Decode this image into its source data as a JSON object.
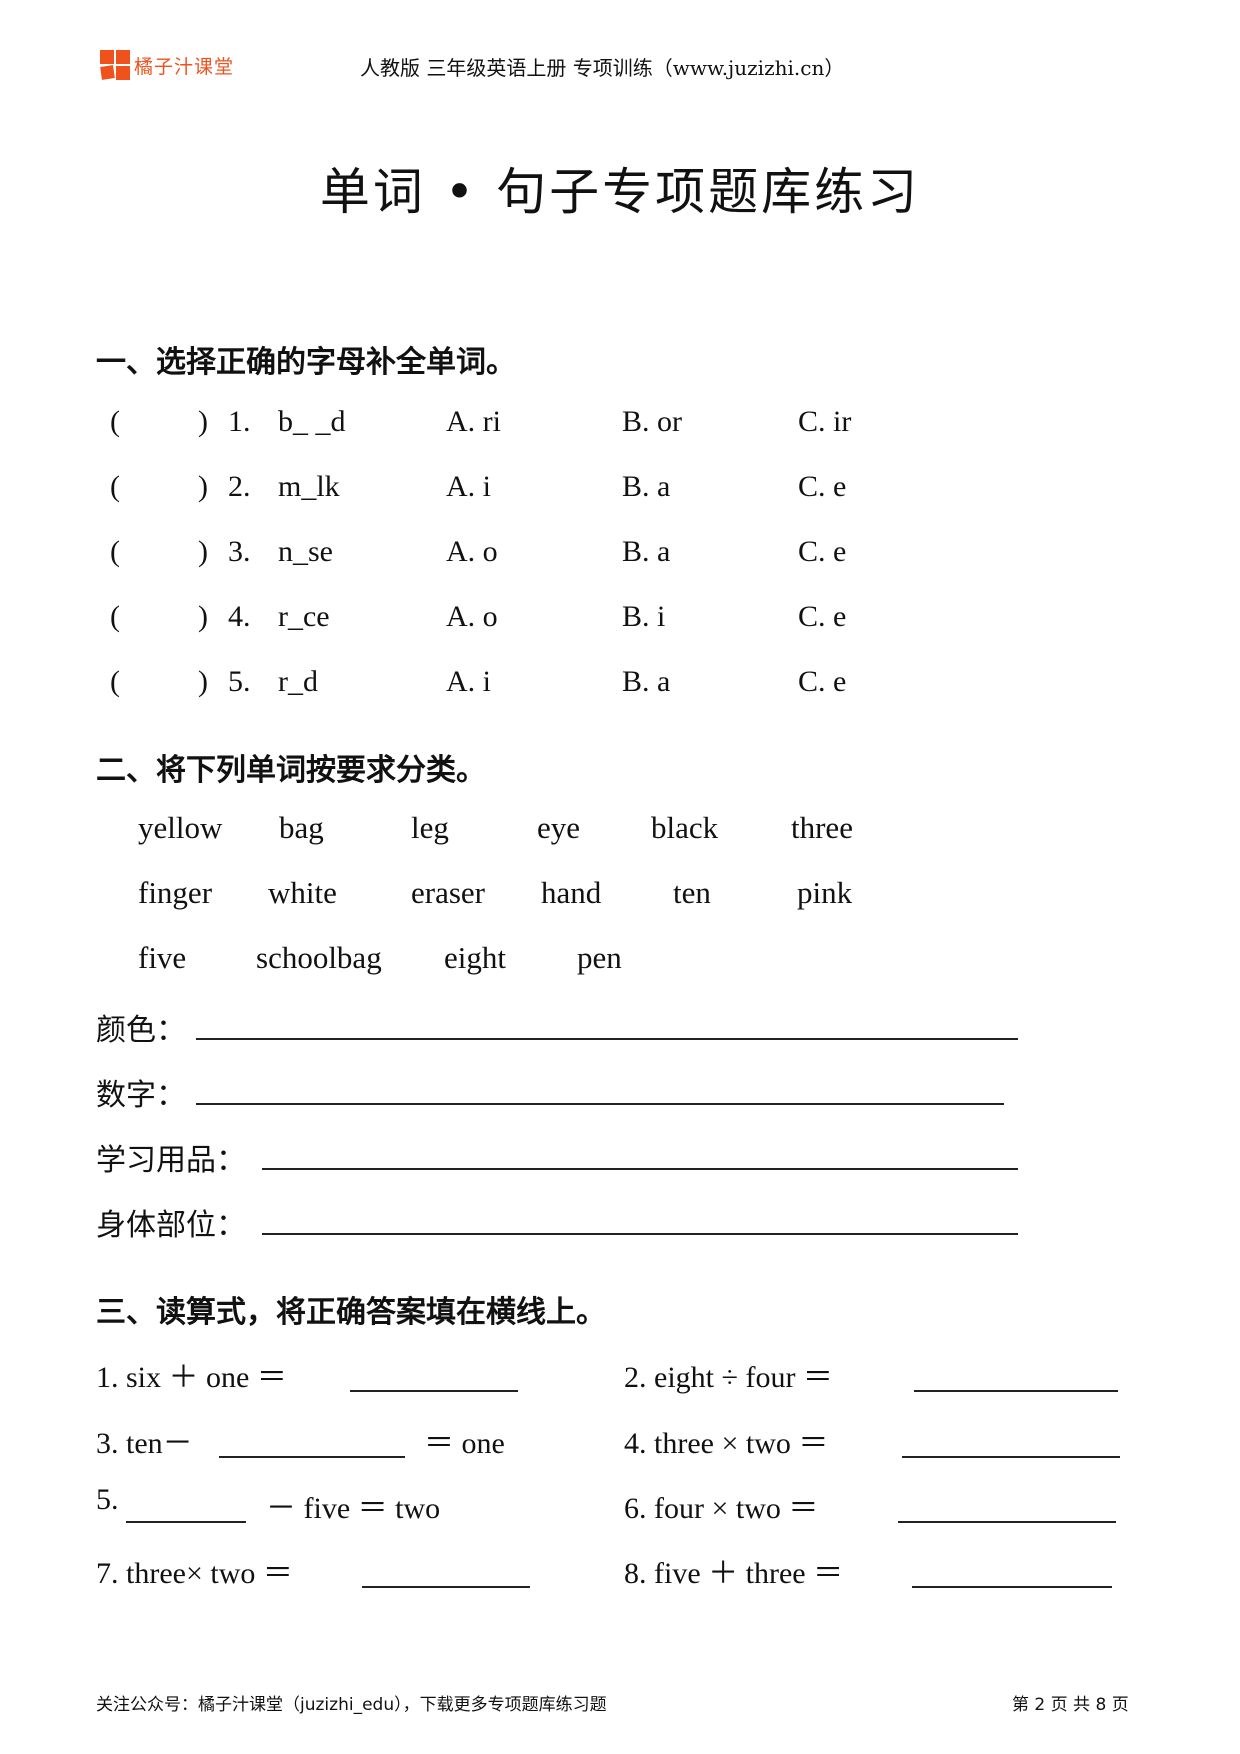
{
  "header": {
    "logo_text": "橘子汁课堂",
    "title": "人教版 三年级英语上册 专项训练（www.juzizhi.cn）",
    "brand_color": "#f0521e"
  },
  "page_title": "单词 • 句子专项题库练习",
  "section1": {
    "title": "一、选择正确的字母补全单词。",
    "questions": [
      {
        "paren_l": "(",
        "paren_r": ")",
        "num": "1.",
        "word": "b_ _d",
        "a": "A. ri",
        "b": "B. or",
        "c": "C.  ir"
      },
      {
        "paren_l": "(",
        "paren_r": ")",
        "num": "2.",
        "word": "m_lk",
        "a": "A. i",
        "b": "B. a",
        "c": "C.  e"
      },
      {
        "paren_l": "(",
        "paren_r": ")",
        "num": "3.",
        "word": "n_se",
        "a": "A. o",
        "b": "B. a",
        "c": "C.  e"
      },
      {
        "paren_l": "(",
        "paren_r": ")",
        "num": "4.",
        "word": "r_ce",
        "a": "A. o",
        "b": "B. i",
        "c": "C.  e"
      },
      {
        "paren_l": "(",
        "paren_r": ")",
        "num": "5.",
        "word": "r_d",
        "a": "A. i",
        "b": "B. a",
        "c": "C.  e"
      }
    ]
  },
  "section2": {
    "title": "二、将下列单词按要求分类。",
    "word_rows": [
      [
        "yellow",
        "bag",
        "leg",
        "eye",
        "black",
        "three"
      ],
      [
        "finger",
        "white",
        "eraser",
        "hand",
        "ten",
        "pink"
      ],
      [
        "five",
        "schoolbag",
        "eight",
        "pen"
      ]
    ],
    "categories": [
      {
        "label": "颜色：",
        "value": ""
      },
      {
        "label": "数字：",
        "value": ""
      },
      {
        "label": "学习用品：",
        "value": ""
      },
      {
        "label": "身体部位：",
        "value": ""
      }
    ]
  },
  "section3": {
    "title": "三、读算式，将正确答案填在横线上。",
    "items": [
      {
        "pre": "1. six  ＋  one  ＝",
        "post": ""
      },
      {
        "pre": "2. eight  ÷  four  ＝",
        "post": ""
      },
      {
        "pre": "3. ten－",
        "post": "＝  one"
      },
      {
        "pre": "4. three  ×  two  ＝",
        "post": ""
      },
      {
        "pre": "5.",
        "post": "－  five  ＝  two"
      },
      {
        "pre": "6. four  ×  two  ＝",
        "post": ""
      },
      {
        "pre": "7. three×  two  ＝",
        "post": ""
      },
      {
        "pre": "8. five  ＋  three  ＝",
        "post": ""
      }
    ]
  },
  "footer": {
    "left": "关注公众号：橘子汁课堂（juzizhi_edu），下载更多专项题库练习题",
    "page_prefix": "第",
    "page_current": "2",
    "page_mid": "页 共",
    "page_total": "8",
    "page_suffix": "页"
  }
}
